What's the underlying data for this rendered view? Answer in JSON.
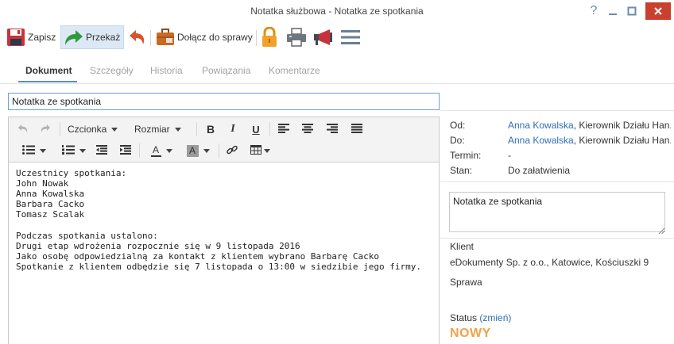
{
  "window": {
    "title": "Notatka służbowa - Notatka ze spotkania",
    "help": "?"
  },
  "toolbar": {
    "save_label": "Zapisz",
    "forward_label": "Przekaż",
    "attach_label": "Dołącz do sprawy"
  },
  "tabs": [
    "Dokument",
    "Szczegóły",
    "Historia",
    "Powiązania",
    "Komentarze"
  ],
  "subject": {
    "value": "Notatka ze spotkania"
  },
  "editor": {
    "font_label": "Czcionka",
    "size_label": "Rozmiar",
    "bold": "B",
    "italic": "I",
    "underline": "U",
    "text_color": "A",
    "bg_color": "A",
    "body": "Uczestnicy spotkania:\nJohn Nowak\nAnna Kowalska\nBarbara Cacko\nTomasz Scalak\n\nPodczas spotkania ustalono:\nDrugi etap wdrożenia rozpocznie się w 9 listopada 2016\nJako osobę odpowiedzialną za kontakt z klientem wybrano Barbarę Cacko\nSpotkanie z klientem odbędzie się 7 listopada o 13:00 w siedzibie jego firmy."
  },
  "meta": {
    "from_label": "Od:",
    "from_name": "Anna Kowalska",
    "from_role": ", Kierownik Działu Han...",
    "to_label": "Do:",
    "to_name": "Anna Kowalska",
    "to_role": ", Kierownik Działu Han...",
    "deadline_label": "Termin:",
    "deadline_value": "-",
    "state_label": "Stan:",
    "state_value": "Do załatwienia"
  },
  "note": {
    "value": "Notatka ze spotkania"
  },
  "client": {
    "label": "Klient",
    "value": "eDokumenty Sp. z o.o., Katowice, Kościuszki 9"
  },
  "case": {
    "label": "Sprawa"
  },
  "status": {
    "label": "Status",
    "change_link": "(zmień)",
    "value": "NOWY"
  },
  "colors": {
    "accent": "#2f6db5",
    "tab_underline": "#5a8ec2",
    "status_new": "#f0a24a",
    "close_button": "#c9402f"
  }
}
